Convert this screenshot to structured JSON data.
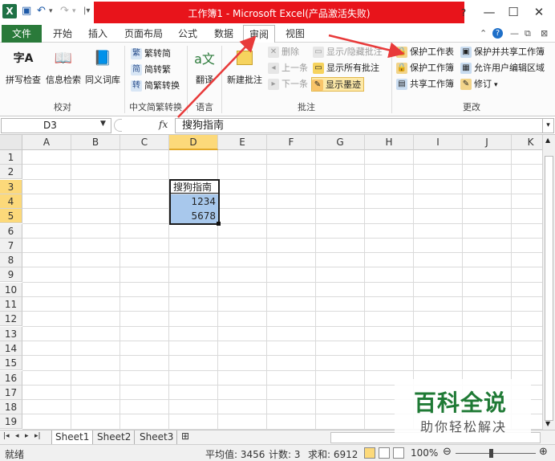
{
  "titlebar": {
    "app_icon": "X",
    "title": "工作簿1 - Microsoft Excel(产品激活失败)",
    "quick_access": [
      "save-icon",
      "undo-icon",
      "redo-icon",
      "customize-icon"
    ],
    "window_buttons": {
      "minimize": "—",
      "restore": "☐",
      "close": "✕"
    }
  },
  "tabs": [
    {
      "label": "文件"
    },
    {
      "label": "开始"
    },
    {
      "label": "插入"
    },
    {
      "label": "页面布局"
    },
    {
      "label": "公式"
    },
    {
      "label": "数据"
    },
    {
      "label": "审阅",
      "active": true
    },
    {
      "label": "视图"
    }
  ],
  "ribbon": {
    "proofing": {
      "group_label": "校对",
      "spelling": "拼写检查",
      "research": "信息检索",
      "thesaurus": "同义词库"
    },
    "chinese": {
      "group_label": "中文简繁转换",
      "trad_to_simp": "繁转简",
      "simp_to_trad": "简转繁",
      "convert": "简繁转换"
    },
    "language": {
      "group_label": "语言",
      "translate": "翻译"
    },
    "comments": {
      "group_label": "批注",
      "new_comment": "新建批注",
      "delete": "删除",
      "previous": "上一条",
      "next": "下一条",
      "show_hide": "显示/隐藏批注",
      "show_all": "显示所有批注",
      "show_ink": "显示墨迹"
    },
    "changes": {
      "group_label": "更改",
      "protect_sheet": "保护工作表",
      "protect_workbook": "保护工作簿",
      "share_workbook": "共享工作簿",
      "protect_share": "保护并共享工作簿",
      "allow_edit_ranges": "允许用户编辑区域",
      "track_changes": "修订"
    }
  },
  "formula_bar": {
    "name_box": "D3",
    "fx": "fx",
    "value": "搜狗指南"
  },
  "columns": [
    "A",
    "B",
    "C",
    "D",
    "E",
    "F",
    "G",
    "H",
    "I",
    "J",
    "K"
  ],
  "rows": [
    "1",
    "2",
    "3",
    "4",
    "5",
    "6",
    "7",
    "8",
    "9",
    "10",
    "11",
    "12",
    "13",
    "14",
    "15",
    "16",
    "17",
    "18",
    "19"
  ],
  "cells": {
    "D3": "搜狗指南",
    "D4": "1234",
    "D5": "5678"
  },
  "sheets": [
    "Sheet1",
    "Sheet2",
    "Sheet3"
  ],
  "statusbar": {
    "ready": "就绪",
    "average": "平均值: 3456",
    "count": "计数: 3",
    "sum": "求和: 6912",
    "zoom": "100%"
  },
  "watermark": {
    "title": "百科全说",
    "subtitle": "助你轻松解决"
  },
  "colors": {
    "excel_green": "#1e7145",
    "title_highlight": "#e8141b",
    "selected_header": "#fcd97a",
    "selected_cell": "#a8c8ec",
    "arrow": "#e83a3a"
  }
}
